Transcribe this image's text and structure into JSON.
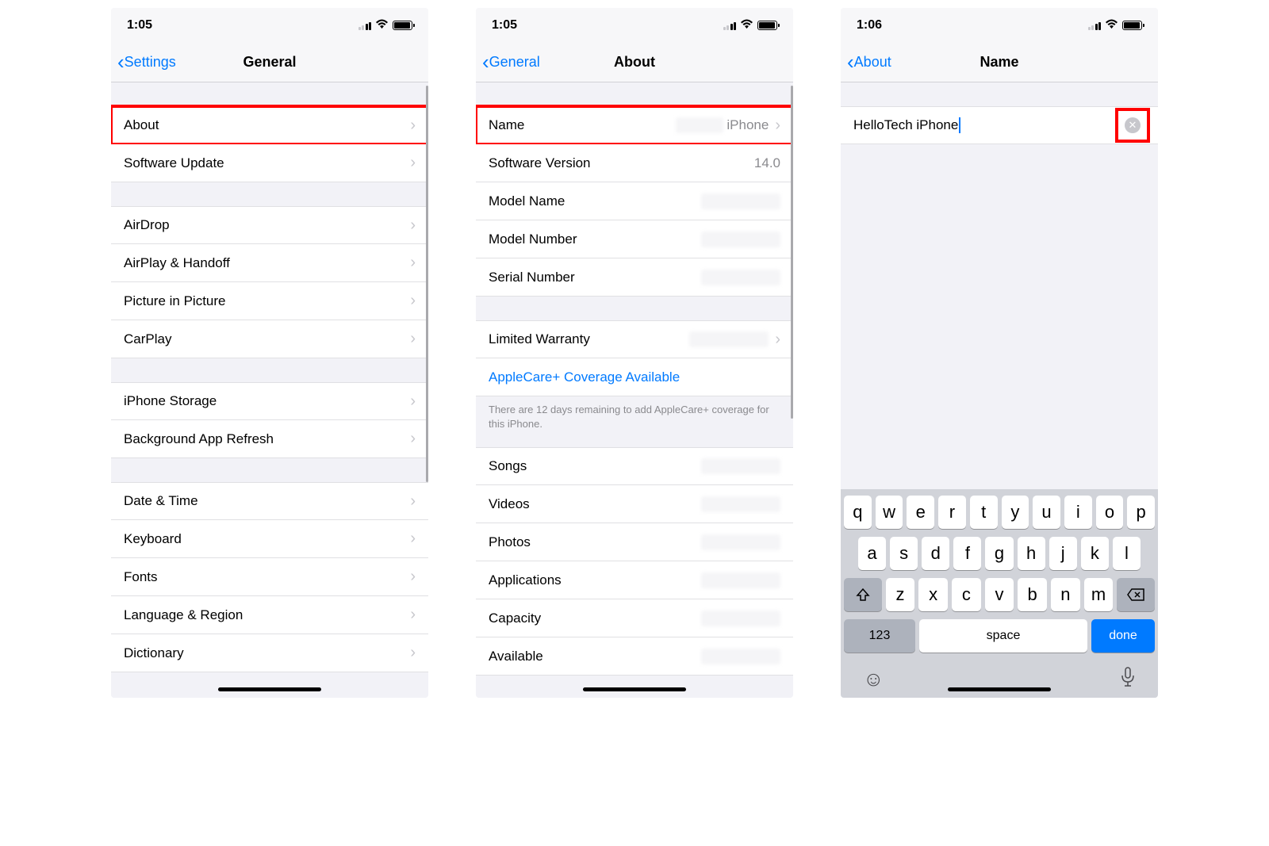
{
  "screen1": {
    "time": "1:05",
    "back": "Settings",
    "title": "General",
    "sections": [
      [
        {
          "label": "About",
          "chevron": true,
          "highlight": true
        },
        {
          "label": "Software Update",
          "chevron": true
        }
      ],
      [
        {
          "label": "AirDrop",
          "chevron": true
        },
        {
          "label": "AirPlay & Handoff",
          "chevron": true
        },
        {
          "label": "Picture in Picture",
          "chevron": true
        },
        {
          "label": "CarPlay",
          "chevron": true
        }
      ],
      [
        {
          "label": "iPhone Storage",
          "chevron": true
        },
        {
          "label": "Background App Refresh",
          "chevron": true
        }
      ],
      [
        {
          "label": "Date & Time",
          "chevron": true
        },
        {
          "label": "Keyboard",
          "chevron": true
        },
        {
          "label": "Fonts",
          "chevron": true
        },
        {
          "label": "Language & Region",
          "chevron": true
        },
        {
          "label": "Dictionary",
          "chevron": true
        }
      ]
    ]
  },
  "screen2": {
    "time": "1:05",
    "back": "General",
    "title": "About",
    "rows1": [
      {
        "label": "Name",
        "value": "iPhone",
        "chevron": true,
        "highlight": true,
        "blurprefix": true
      },
      {
        "label": "Software Version",
        "value": "14.0"
      },
      {
        "label": "Model Name",
        "blurred": true
      },
      {
        "label": "Model Number",
        "blurred": true
      },
      {
        "label": "Serial Number",
        "blurred": true
      }
    ],
    "rows2": [
      {
        "label": "Limited Warranty",
        "blurred": true,
        "chevron": true
      },
      {
        "label": "AppleCare+ Coverage Available",
        "link": true
      }
    ],
    "footer": "There are 12 days remaining to add AppleCare+ coverage for this iPhone.",
    "rows3": [
      {
        "label": "Songs",
        "blurred": true
      },
      {
        "label": "Videos",
        "blurred": true
      },
      {
        "label": "Photos",
        "blurred": true
      },
      {
        "label": "Applications",
        "blurred": true
      },
      {
        "label": "Capacity",
        "blurred": true
      },
      {
        "label": "Available",
        "blurred": true
      }
    ]
  },
  "screen3": {
    "time": "1:06",
    "back": "About",
    "title": "Name",
    "input_value": "HelloTech iPhone",
    "keyboard": {
      "row1": [
        "q",
        "w",
        "e",
        "r",
        "t",
        "y",
        "u",
        "i",
        "o",
        "p"
      ],
      "row2": [
        "a",
        "s",
        "d",
        "f",
        "g",
        "h",
        "j",
        "k",
        "l"
      ],
      "row3": [
        "z",
        "x",
        "c",
        "v",
        "b",
        "n",
        "m"
      ],
      "numbers": "123",
      "space": "space",
      "done": "done"
    }
  }
}
